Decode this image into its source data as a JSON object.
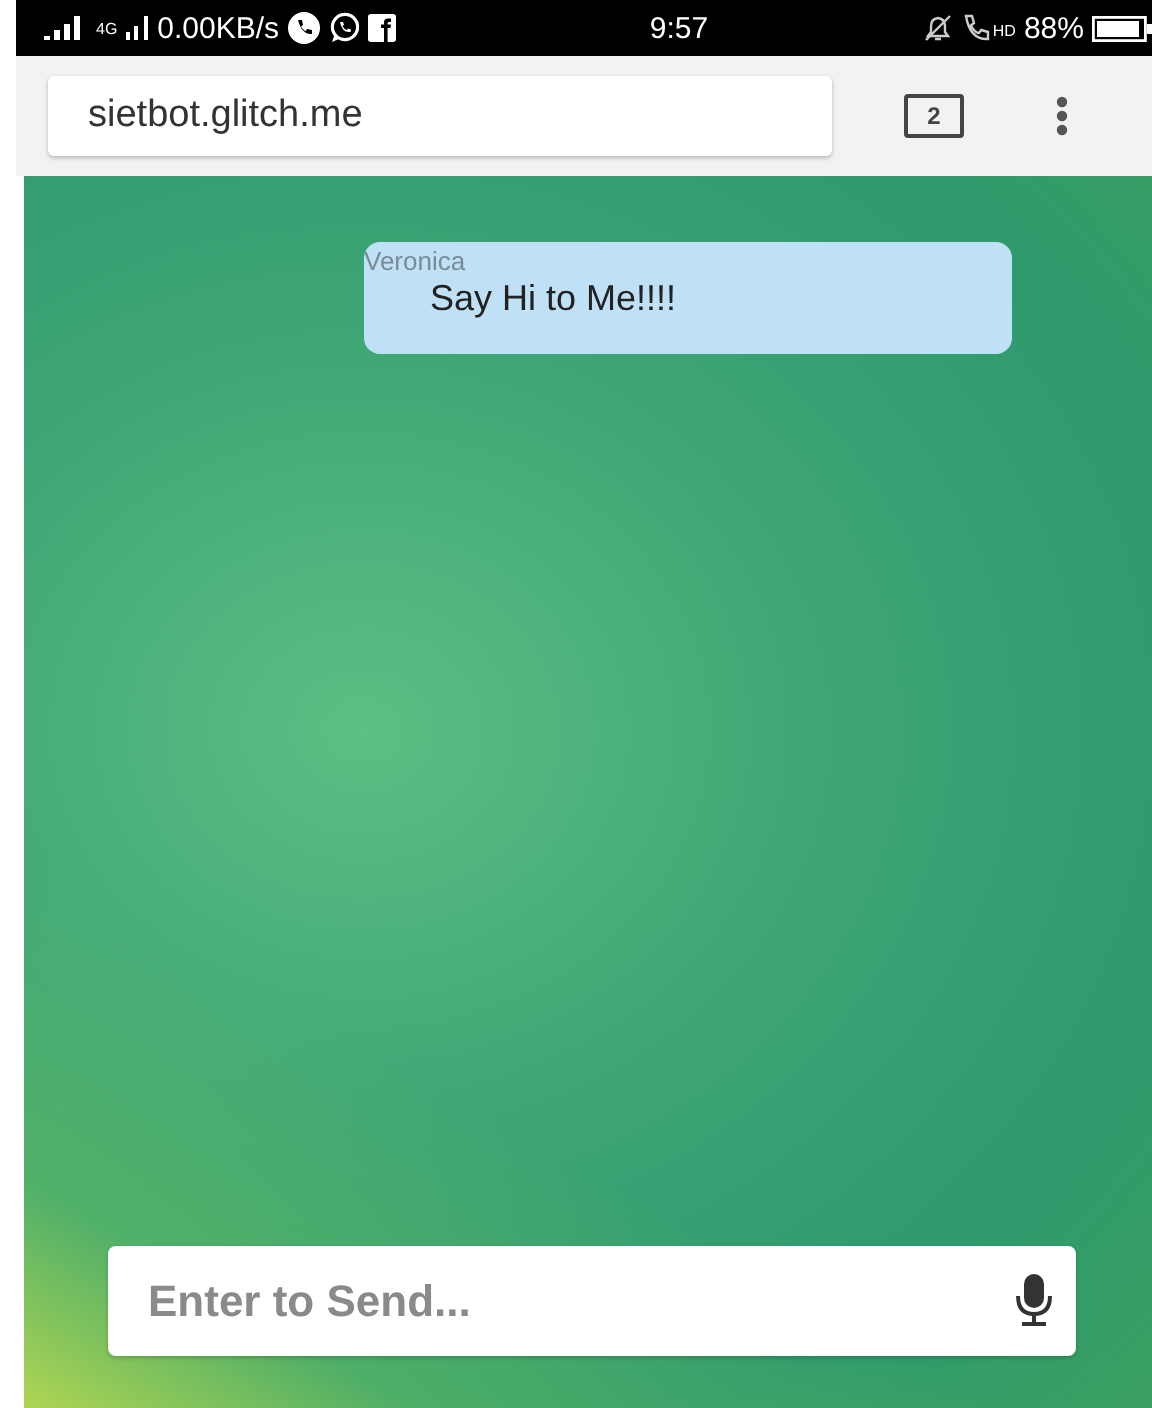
{
  "status_bar": {
    "network_type": "4G",
    "data_rate": "0.00KB/s",
    "time": "9:57",
    "call_quality": "HD",
    "battery": "88%"
  },
  "browser": {
    "url": "sietbot.glitch.me",
    "tab_count": "2"
  },
  "messages": [
    {
      "sender": "Veronica",
      "text": "Say Hi to Me!!!!"
    }
  ],
  "composer": {
    "placeholder": "Enter to Send..."
  }
}
